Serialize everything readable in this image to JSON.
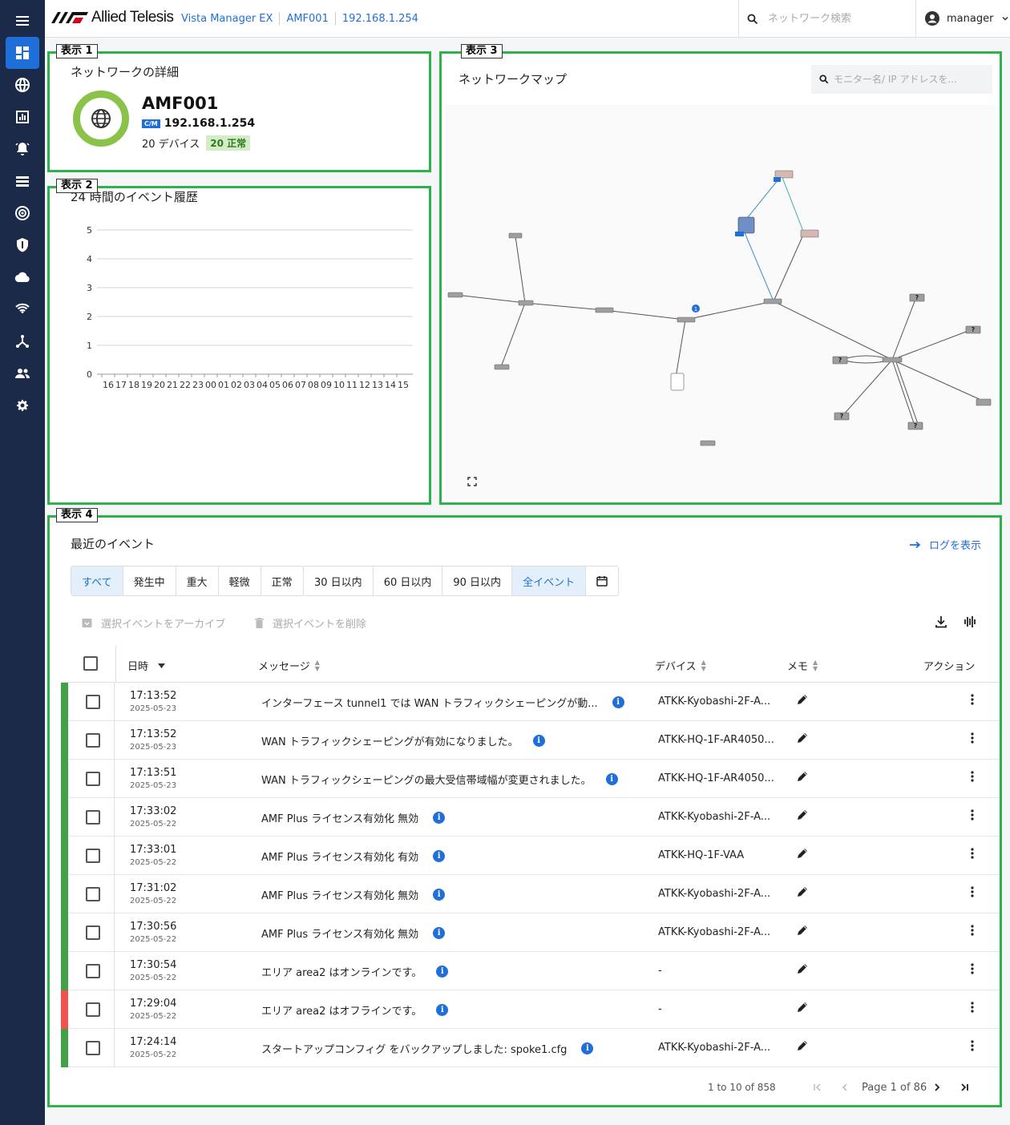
{
  "header": {
    "logo_text": "Allied Telesis",
    "breadcrumbs": [
      "Vista Manager EX",
      "AMF001",
      "192.168.1.254"
    ],
    "search_placeholder": "ネットワーク検索",
    "user": "manager"
  },
  "sidebar": {
    "items": [
      "menu-icon",
      "dashboard-icon",
      "globe-icon",
      "chart-icon",
      "alarm-icon",
      "list-icon",
      "radar-icon",
      "shield-icon",
      "cloud-icon",
      "wifi-icon",
      "topology-icon",
      "users-icon",
      "gear-icon"
    ],
    "active": "dashboard-icon"
  },
  "frames": {
    "f1": "表示 1",
    "f2": "表示 2",
    "f3": "表示 3",
    "f4": "表示 4"
  },
  "network_details": {
    "title": "ネットワークの詳細",
    "name": "AMF001",
    "cm_badge": "C/M",
    "ip": "192.168.1.254",
    "device_count": "20 デバイス",
    "ok_badge": "20 正常",
    "ring_color": "#8bc34a"
  },
  "event_history": {
    "title": "24 時間のイベント履歴"
  },
  "chart_data": {
    "type": "bar",
    "categories": [
      "16",
      "17",
      "18",
      "19",
      "20",
      "21",
      "22",
      "23",
      "00",
      "01",
      "02",
      "03",
      "04",
      "05",
      "06",
      "07",
      "08",
      "09",
      "10",
      "11",
      "12",
      "13",
      "14",
      "15"
    ],
    "values": [
      0,
      0,
      0,
      0,
      0,
      0,
      0,
      0,
      0,
      0,
      0,
      0,
      0,
      0,
      0,
      0,
      0,
      0,
      0,
      0,
      0,
      0,
      0,
      0
    ],
    "yticks": [
      "0",
      "1",
      "2",
      "3",
      "4",
      "5"
    ],
    "ylim": [
      0,
      5
    ],
    "grid": true
  },
  "network_map": {
    "title": "ネットワークマップ",
    "search_placeholder": "モニター名/ IP アドレスを...",
    "badge_count": "1",
    "unknown_label": "?"
  },
  "events": {
    "title": "最近のイベント",
    "log_link": "ログを表示",
    "severity_filters": [
      "すべて",
      "発生中",
      "重大",
      "軽微",
      "正常"
    ],
    "severity_selected": "すべて",
    "period_filters": [
      "30 日以内",
      "60 日以内",
      "90 日以内",
      "全イベント"
    ],
    "period_selected": "全イベント",
    "archive_label": "選択イベントをアーカイブ",
    "delete_label": "選択イベントを削除",
    "columns": {
      "datetime": "日時",
      "message": "メッセージ",
      "device": "デバイス",
      "memo": "メモ",
      "action": "アクション"
    },
    "rows": [
      {
        "time": "17:13:52",
        "date": "2025-05-23",
        "message": "インターフェース tunnel1 では WAN トラフィックシェーピングが動...",
        "device": "ATKK-Kyobashi-2F-A...",
        "status": "ok"
      },
      {
        "time": "17:13:52",
        "date": "2025-05-23",
        "message": "WAN トラフィックシェーピングが有効になりました。",
        "device": "ATKK-HQ-1F-AR4050...",
        "status": "ok"
      },
      {
        "time": "17:13:51",
        "date": "2025-05-23",
        "message": "WAN トラフィックシェーピングの最大受信帯域幅が変更されました。",
        "device": "ATKK-HQ-1F-AR4050...",
        "status": "ok"
      },
      {
        "time": "17:33:02",
        "date": "2025-05-22",
        "message": "AMF Plus ライセンス有効化 無効",
        "device": "ATKK-Kyobashi-2F-A...",
        "status": "ok"
      },
      {
        "time": "17:33:01",
        "date": "2025-05-22",
        "message": "AMF Plus ライセンス有効化 有効",
        "device": "ATKK-HQ-1F-VAA",
        "status": "ok"
      },
      {
        "time": "17:31:02",
        "date": "2025-05-22",
        "message": "AMF Plus ライセンス有効化 無効",
        "device": "ATKK-Kyobashi-2F-A...",
        "status": "ok"
      },
      {
        "time": "17:30:56",
        "date": "2025-05-22",
        "message": "AMF Plus ライセンス有効化 無効",
        "device": "ATKK-Kyobashi-2F-A...",
        "status": "ok"
      },
      {
        "time": "17:30:54",
        "date": "2025-05-22",
        "message": "エリア area2 はオンラインです。",
        "device": "-",
        "status": "ok"
      },
      {
        "time": "17:29:04",
        "date": "2025-05-22",
        "message": "エリア area2 はオフラインです。",
        "device": "-",
        "status": "error"
      },
      {
        "time": "17:24:14",
        "date": "2025-05-22",
        "message": "スタートアップコンフィグ をバックアップしました: spoke1.cfg",
        "device": "ATKK-Kyobashi-2F-A...",
        "status": "ok"
      }
    ],
    "status_colors": {
      "ok": "#43a047",
      "error": "#ef5350"
    },
    "info_label": "i",
    "pagination": {
      "range": "1 to 10 of 858",
      "page": "Page 1 of 86"
    }
  }
}
